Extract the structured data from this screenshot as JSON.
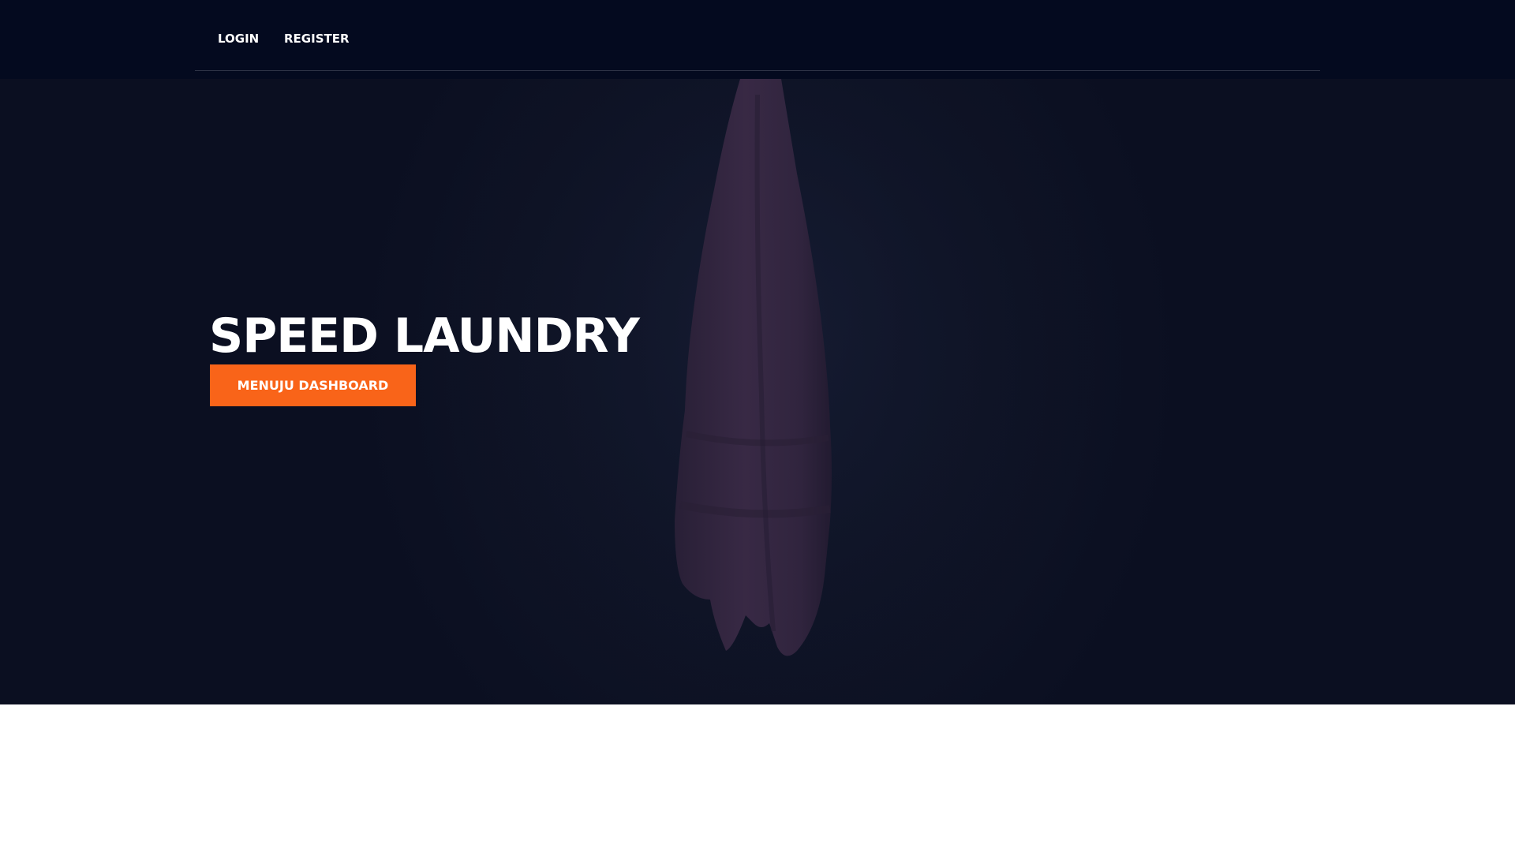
{
  "nav": {
    "login_label": "LOGIN",
    "register_label": "REGISTER"
  },
  "hero": {
    "title": "SPEED LAUNDRY",
    "button_label": "MENUJU DASHBOARD"
  },
  "colors": {
    "navbar_bg": "#040a1f",
    "hero_bg": "#0f1426",
    "button_bg": "#f96419",
    "text": "#ffffff"
  }
}
